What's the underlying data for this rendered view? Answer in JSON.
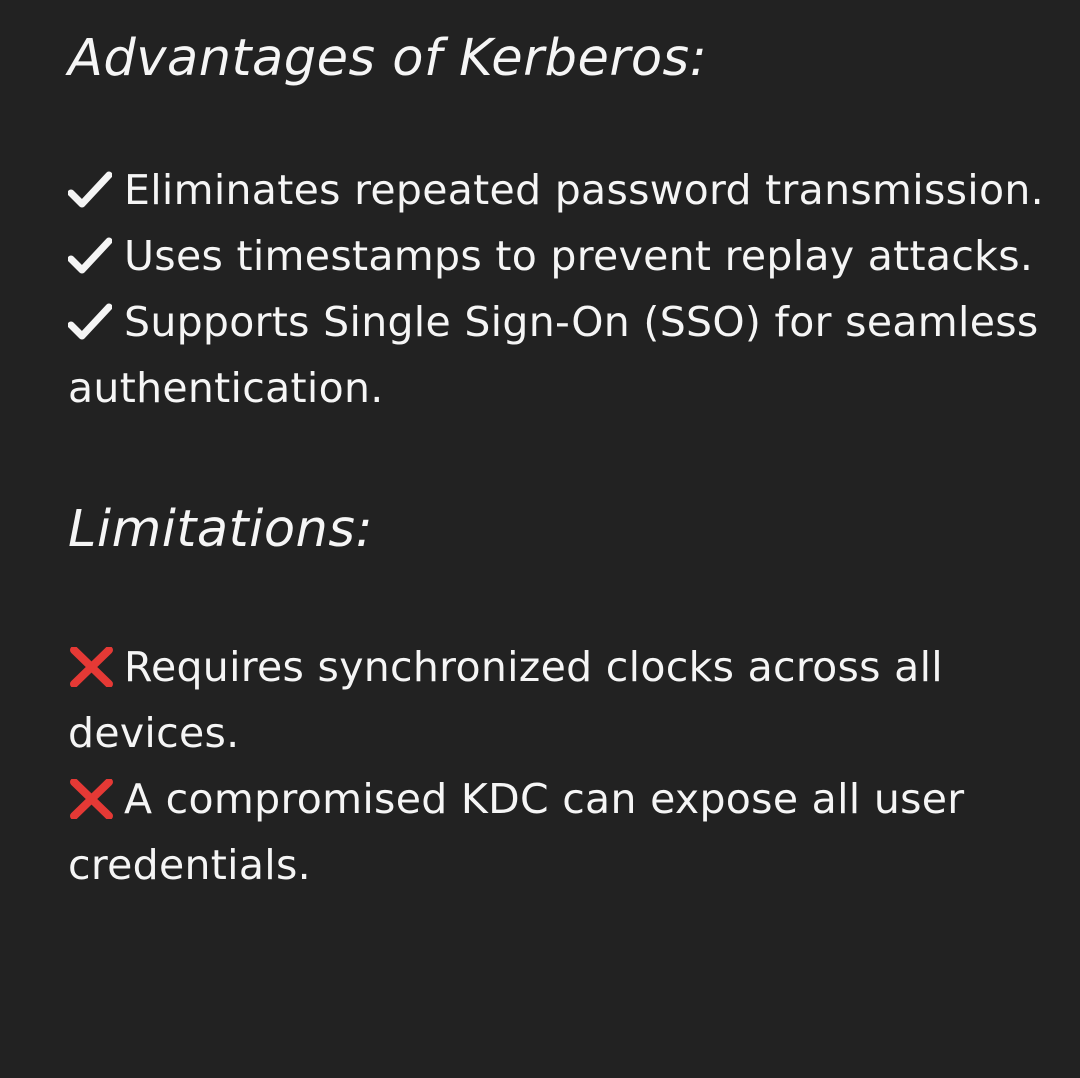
{
  "advantages": {
    "heading": "Advantages of Kerberos:",
    "items": [
      {
        "icon": "check-mark-icon",
        "text": "Eliminates repeated password transmission."
      },
      {
        "icon": "check-mark-icon",
        "text": "Uses timestamps to prevent replay attacks."
      },
      {
        "icon": "check-mark-icon",
        "text": "Supports Single Sign-On (SSO) for seamless authentication."
      }
    ]
  },
  "limitations": {
    "heading": "Limitations:",
    "items": [
      {
        "icon": "cross-mark-icon",
        "text": "Requires synchronized clocks across all devices."
      },
      {
        "icon": "cross-mark-icon",
        "text": "A compromised KDC can expose all user credentials."
      }
    ]
  },
  "colors": {
    "background": "#222222",
    "text": "#f5f5f5",
    "cross": "#e53935"
  }
}
